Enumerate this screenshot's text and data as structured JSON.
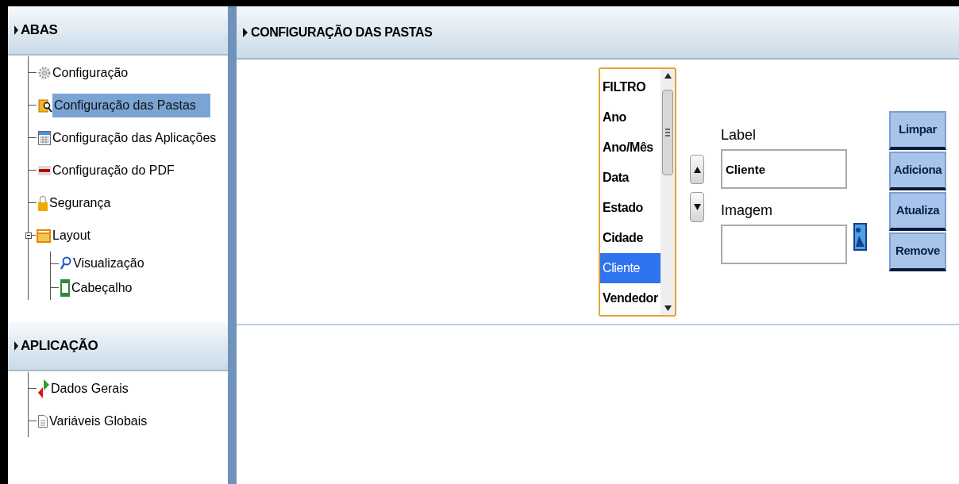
{
  "sidebar": {
    "sections": [
      {
        "title": "ABAS",
        "items": [
          {
            "label": "Configuração",
            "selected": false
          },
          {
            "label": "Configuração das Pastas",
            "selected": true
          },
          {
            "label": "Configuração das Aplicações",
            "selected": false
          },
          {
            "label": "Configuração do PDF",
            "selected": false
          },
          {
            "label": "Segurança",
            "selected": false
          },
          {
            "label": "Layout",
            "selected": false,
            "expanded": true,
            "children": [
              {
                "label": "Visualização",
                "selected": false
              },
              {
                "label": "Cabeçalho",
                "selected": false
              }
            ]
          }
        ]
      },
      {
        "title": "APLICAÇÃO",
        "items": [
          {
            "label": "Dados Gerais",
            "selected": false
          },
          {
            "label": "Variáveis Globais",
            "selected": false
          }
        ]
      }
    ]
  },
  "panel": {
    "title": "CONFIGURAÇÃO DAS PASTAS",
    "list": [
      {
        "label": "FILTRO",
        "selected": false
      },
      {
        "label": "Ano",
        "selected": false
      },
      {
        "label": "Ano/Mês",
        "selected": false
      },
      {
        "label": "Data",
        "selected": false
      },
      {
        "label": "Estado",
        "selected": false
      },
      {
        "label": "Cidade",
        "selected": false
      },
      {
        "label": "Cliente",
        "selected": true
      },
      {
        "label": "Vendedor",
        "selected": false
      }
    ],
    "label_field": {
      "label": "Label",
      "value": "Cliente"
    },
    "image_field": {
      "label": "Imagem"
    },
    "buttons": [
      "Limpar",
      "Adiciona",
      "Atualiza",
      "Remove"
    ]
  }
}
